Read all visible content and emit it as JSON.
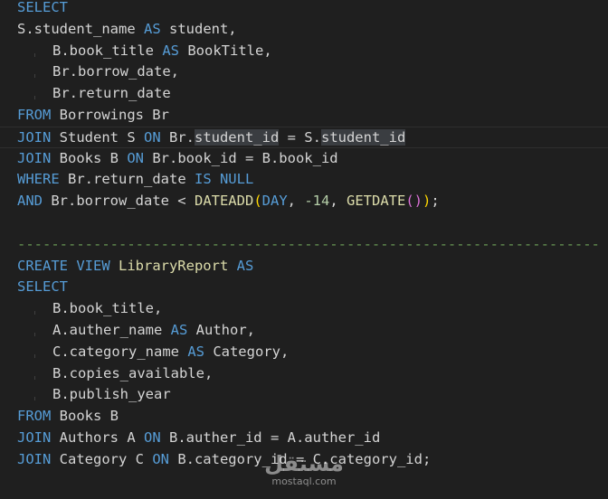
{
  "colors": {
    "background": "#1f1f1f",
    "keyword": "#569cd6",
    "function": "#dcdcaa",
    "number": "#b5cea8",
    "text": "#d4d4d4",
    "comment": "#6a9955"
  },
  "code": {
    "q1": {
      "l1_kw": "SELECT",
      "l2_a": "S.student_name ",
      "l2_kw": "AS",
      "l2_b": " student,",
      "l3_a": "B.book_title ",
      "l3_kw": "AS",
      "l3_b": " BookTitle,",
      "l4": "Br.borrow_date,",
      "l5": "Br.return_date",
      "l6_kw": "FROM",
      "l6_b": " Borrowings Br",
      "l7_kw": "JOIN",
      "l7_a": " Student S ",
      "l7_kw2": "ON",
      "l7_b": " Br.",
      "l7_hl1": "student_id",
      "l7_c": " = S.",
      "l7_hl2": "student_id",
      "l8_kw": "JOIN",
      "l8_a": " Books B ",
      "l8_kw2": "ON",
      "l8_b": " Br.book_id = B.book_id",
      "l9_kw": "WHERE",
      "l9_a": " Br.return_date ",
      "l9_kw2": "IS NULL",
      "l10_kw": "AND",
      "l10_a": " Br.borrow_date < ",
      "l10_fn": "DATEADD",
      "l10_p1": "(",
      "l10_day": "DAY",
      "l10_b": ", ",
      "l10_num": "-14",
      "l10_c": ", ",
      "l10_fn2": "GETDATE",
      "l10_p2": "()",
      "l10_p3": ")",
      "l10_end": ";"
    },
    "separator": "---------------------------------------------------------------------",
    "q2": {
      "l1_kw": "CREATE VIEW",
      "l1_fn": " LibraryReport ",
      "l1_kw2": "AS",
      "l2_kw": "SELECT",
      "l3": "B.book_title,",
      "l4_a": "A.auther_name ",
      "l4_kw": "AS",
      "l4_b": " Author,",
      "l5_a": "C.category_name ",
      "l5_kw": "AS",
      "l5_b": " Category,",
      "l6": "B.copies_available,",
      "l7": "B.publish_year",
      "l8_kw": "FROM",
      "l8_b": " Books B",
      "l9_kw": "JOIN",
      "l9_a": " Authors A ",
      "l9_kw2": "ON",
      "l9_b": " B.auther_id = A.auther_id",
      "l10_kw": "JOIN",
      "l10_a": " Category C ",
      "l10_kw2": "ON",
      "l10_b": " B.category_id = C.category_id;"
    }
  },
  "watermark": {
    "logo": "مستقل",
    "url": "mostaql.com"
  }
}
